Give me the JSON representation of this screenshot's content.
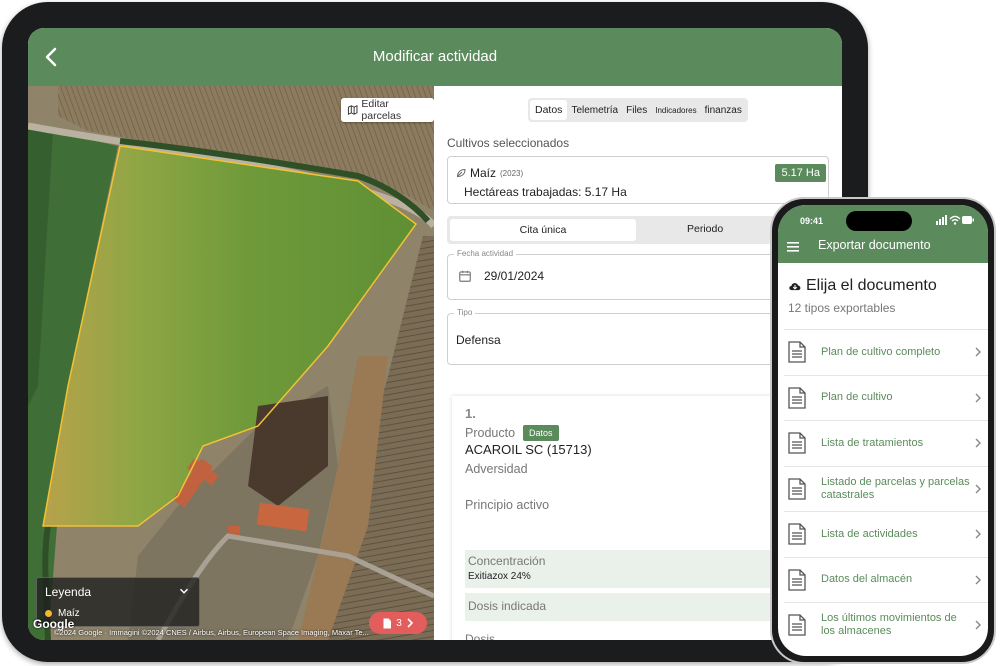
{
  "tablet": {
    "header": {
      "title": "Modificar actividad"
    },
    "map": {
      "edit_button": "Editar parcelas",
      "legend": {
        "title": "Leyenda",
        "items": [
          {
            "label": "Maíz",
            "color": "#f2b632"
          }
        ]
      },
      "google_logo": "Google",
      "copyright": "©2024 Google · Immagini ©2024 CNES / Airbus, Airbus, European Space Imaging, Maxar Te...",
      "badge_count": "3"
    },
    "form": {
      "tabs": [
        "Datos",
        "Telemetría",
        "Files",
        "Indicadores",
        "finanzas"
      ],
      "active_tab": "Datos",
      "cultivos_label": "Cultivos seleccionados",
      "crop": {
        "name": "Maíz",
        "year": "(2023)",
        "worked": "Hectáreas trabajadas: 5.17 Ha",
        "area": "5.17 Ha"
      },
      "segment": {
        "left": "Cita única",
        "right": "Periodo"
      },
      "fecha": {
        "label": "Fecha actividad",
        "value": "29/01/2024"
      },
      "tipo": {
        "label": "Tipo",
        "value": "Defensa"
      },
      "product": {
        "number": "1.",
        "label": "Producto",
        "badge": "Datos",
        "name": "ACAROIL SC (15713)",
        "adversidad": "Adversidad",
        "principio": "Principio activo",
        "concentracion_label": "Concentración",
        "concentracion_value": "Exitiazox 24%",
        "dosis_label": "Dosis indicada",
        "more_label": "Dosis..."
      }
    }
  },
  "phone": {
    "time": "09:41",
    "title": "Exportar documento",
    "heading": "Elija el documento",
    "subheading": "12 tipos exportables",
    "items": [
      "Plan de cultivo completo",
      "Plan de cultivo",
      "Lista de tratamientos",
      "Listado de parcelas y parcelas catastrales",
      "Lista de actividades",
      "Datos del almacén",
      "Los últimos movimientos de los almacenes"
    ]
  },
  "colors": {
    "brand_green": "#5b8b5c",
    "crop_yellow": "#f2b632",
    "alert_red": "#e35d5d"
  }
}
